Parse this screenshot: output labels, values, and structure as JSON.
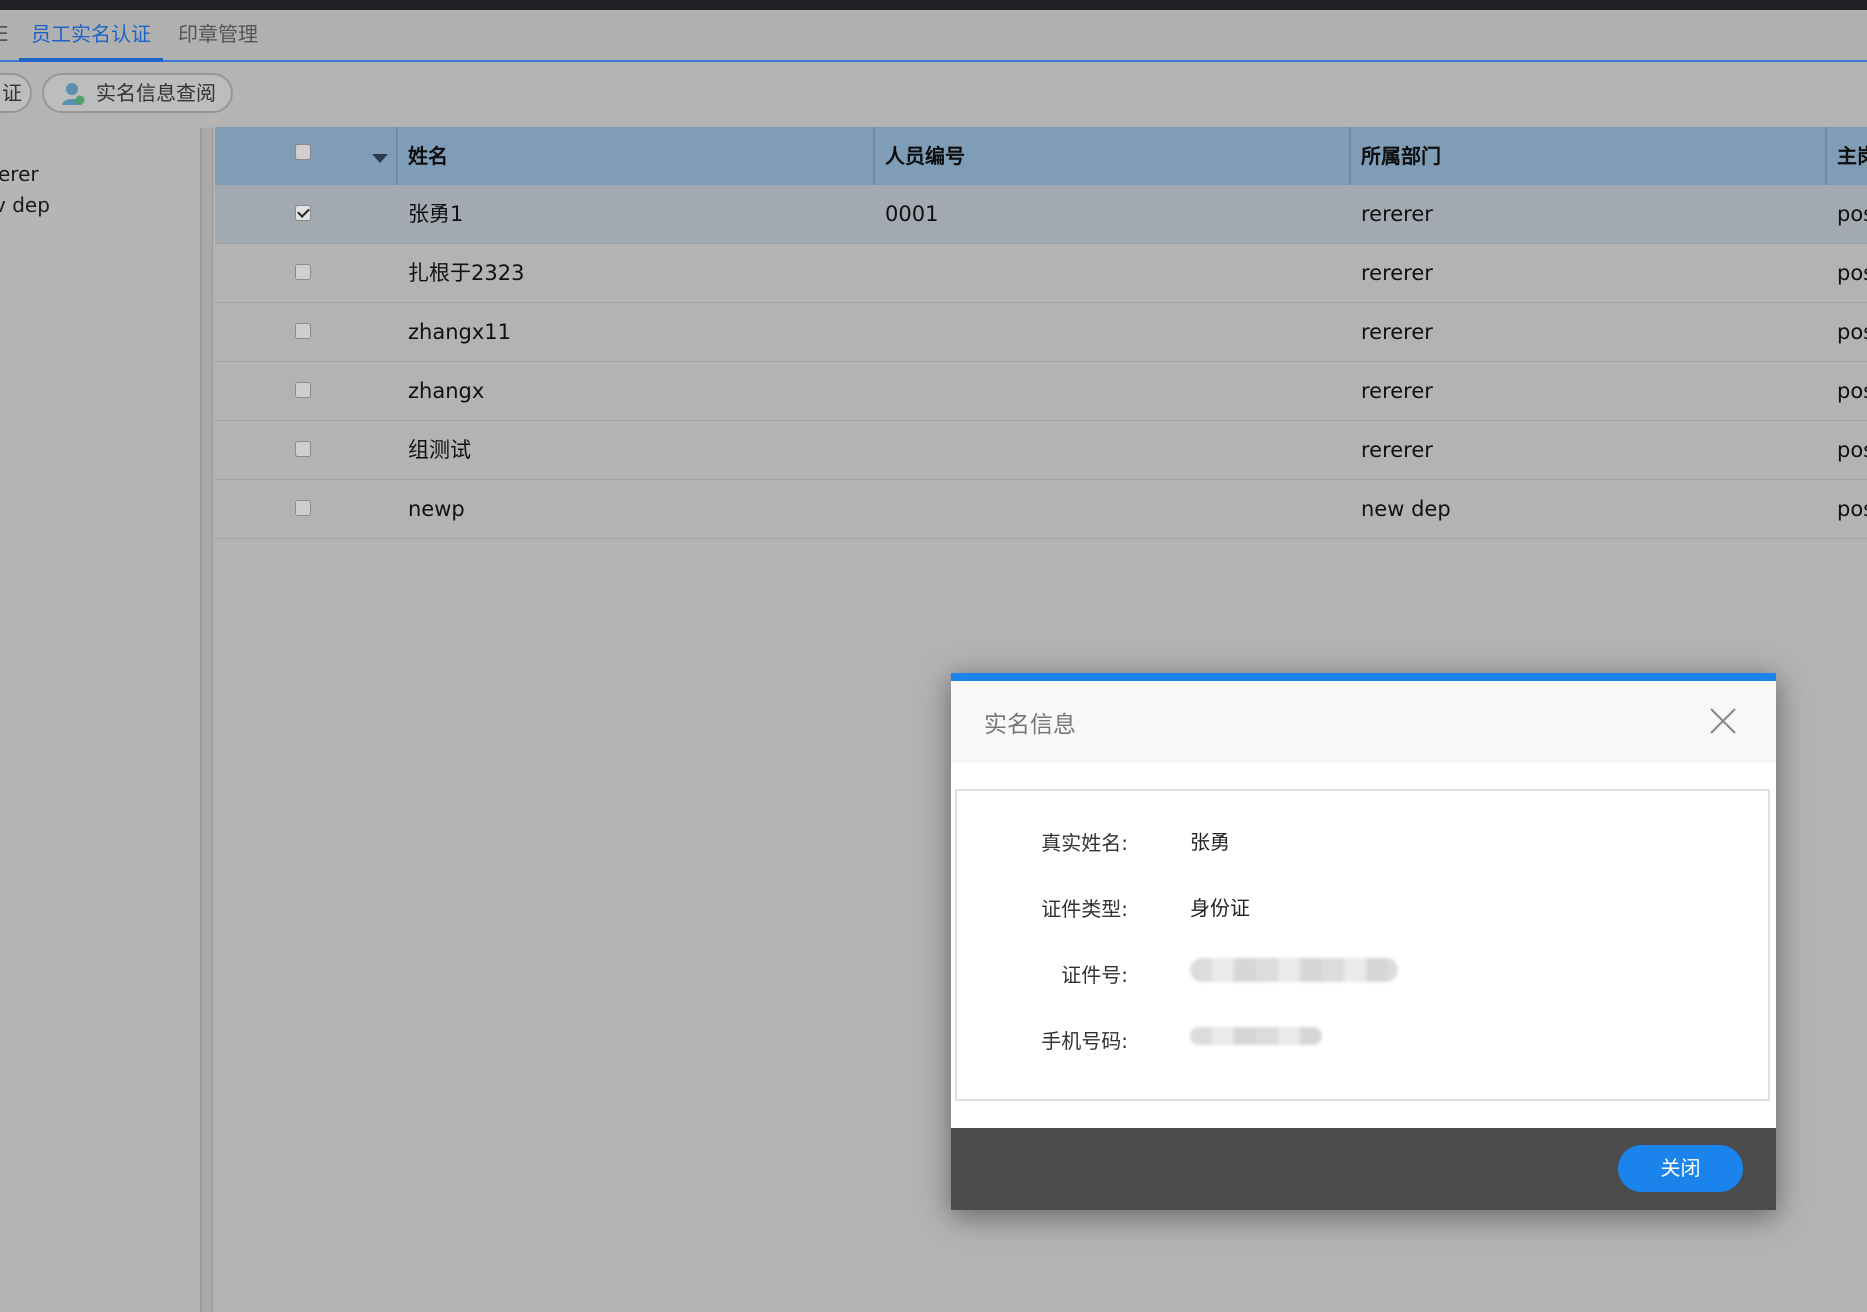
{
  "tabs": [
    {
      "label": "E"
    },
    {
      "label": "员工实名认证",
      "active": true
    },
    {
      "label": "印章管理"
    }
  ],
  "toolbar": {
    "partial_button_label": "证",
    "view_info_button_label": "实名信息查阅"
  },
  "tree": {
    "items": [
      {
        "label": "erer"
      },
      {
        "label": "v dep"
      }
    ]
  },
  "table": {
    "columns": [
      "姓名",
      "人员编号",
      "所属部门",
      "主岗"
    ],
    "rows": [
      {
        "checked": true,
        "name": "张勇1",
        "code": "0001",
        "department": "rererer",
        "post": "pos"
      },
      {
        "checked": false,
        "name": "扎根于2323",
        "code": "",
        "department": "rererer",
        "post": "pos"
      },
      {
        "checked": false,
        "name": "zhangx11",
        "code": "",
        "department": "rererer",
        "post": "pos"
      },
      {
        "checked": false,
        "name": "zhangx",
        "code": "",
        "department": "rererer",
        "post": "pos"
      },
      {
        "checked": false,
        "name": "组测试",
        "code": "",
        "department": "rererer",
        "post": "pos"
      },
      {
        "checked": false,
        "name": "newp",
        "code": "",
        "department": "new dep",
        "post": "pos"
      }
    ]
  },
  "modal": {
    "title": "实名信息",
    "fields": [
      {
        "label": "真实姓名:",
        "value": "张勇"
      },
      {
        "label": "证件类型:",
        "value": "身份证"
      },
      {
        "label": "证件号:",
        "value": ""
      },
      {
        "label": "手机号码:",
        "value": ""
      }
    ],
    "close_button_label": "关闭"
  },
  "colors": {
    "accent": "#1b83ea",
    "header_bg": "#7f9db7",
    "selected_row": "#a2a9b0",
    "footer_bg": "#4b4b4b"
  }
}
